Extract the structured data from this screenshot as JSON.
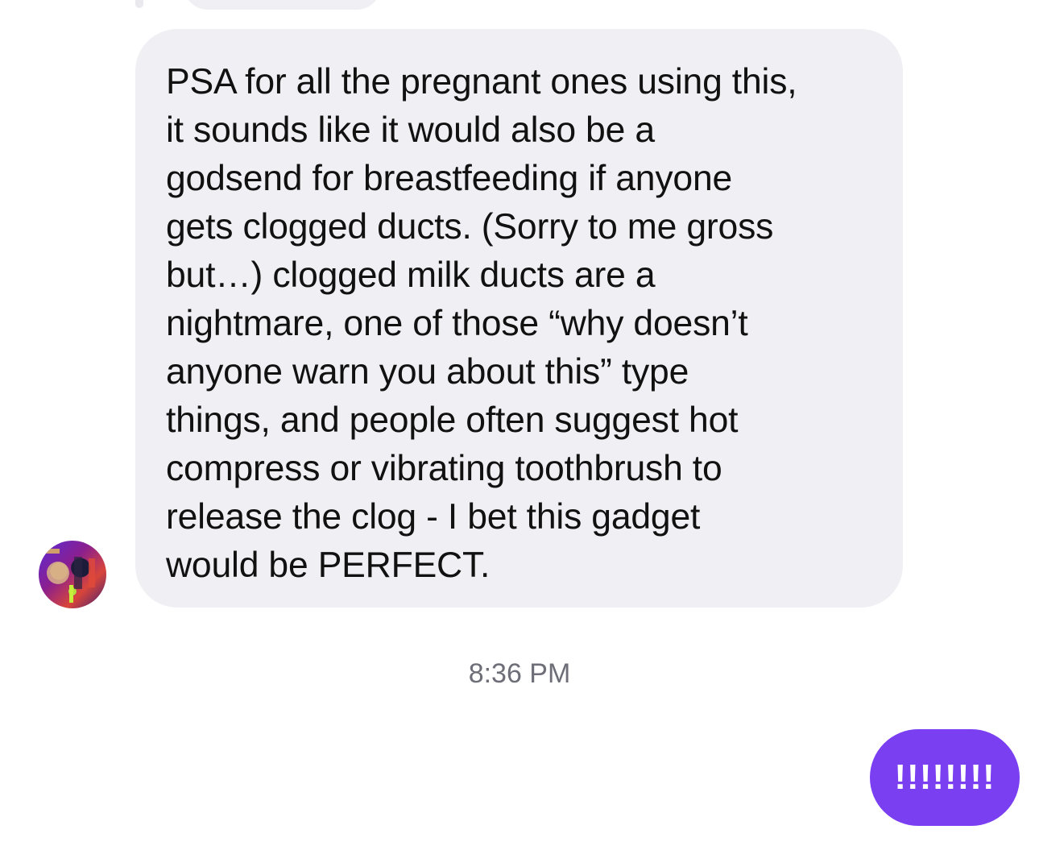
{
  "conversation": {
    "incoming_message": {
      "text": "PSA for all the pregnant ones using this,\nit sounds like it would also be a\ngodsend for breastfeeding if anyone\ngets clogged ducts. (Sorry to me gross\nbut…) clogged milk ducts are a\nnightmare, one of those “why doesn’t\nanyone warn you about this” type\nthings, and people often suggest hot\ncompress or vibrating toothbrush to\nrelease the clog - I bet this gadget\nwould be PERFECT.",
      "bubble_color": "#f0f0f4",
      "text_color": "#111111"
    },
    "timestamp": "8:36 PM",
    "outgoing_message": {
      "text": "!!!!!!!!",
      "bubble_color": "#7b3ff2",
      "text_color": "#ffffff"
    },
    "sender_avatar": {
      "icon": "user-photo-avatar"
    }
  }
}
